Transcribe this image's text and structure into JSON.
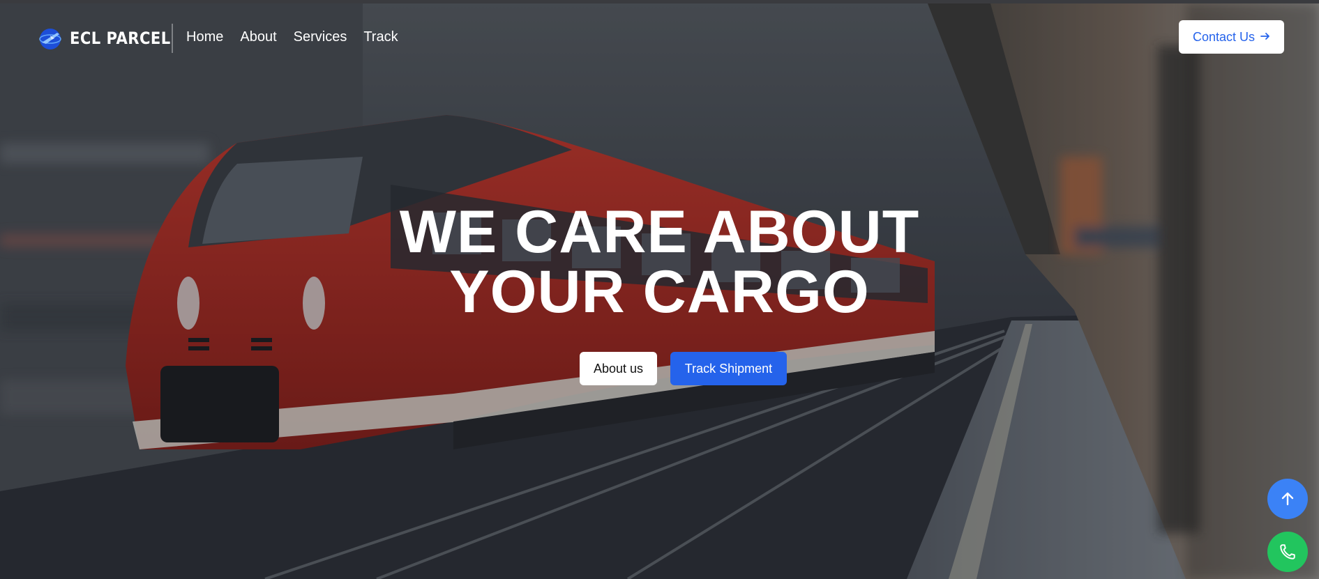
{
  "brand": {
    "name": "ECL PARCEL",
    "logo_icon": "globe-plane-icon"
  },
  "nav": {
    "items": [
      {
        "label": "Home"
      },
      {
        "label": "About"
      },
      {
        "label": "Services"
      },
      {
        "label": "Track"
      }
    ],
    "contact_label": "Contact Us",
    "contact_icon": "arrow-right-icon"
  },
  "hero": {
    "line1": "WE CARE ABOUT",
    "line2": "YOUR CARGO",
    "about_button": "About us",
    "track_button": "Track Shipment",
    "background": "red high-speed train at station platform"
  },
  "floating": {
    "scroll_top_icon": "arrow-up-icon",
    "call_icon": "phone-icon"
  },
  "colors": {
    "accent_blue": "#2563eb",
    "fab_blue": "#3b82f6",
    "fab_green": "#22c55e",
    "train_red": "#c8281e"
  }
}
